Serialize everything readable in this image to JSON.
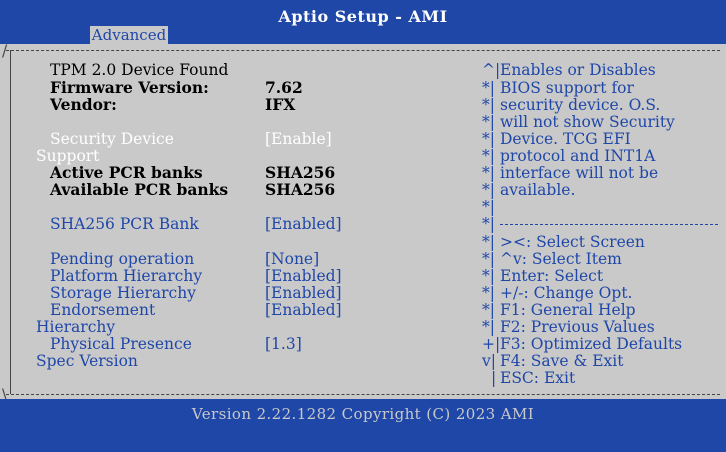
{
  "header": {
    "title": "Aptio Setup - AMI",
    "tab_label": "Advanced"
  },
  "left": {
    "tpm_found": "TPM 2.0 Device Found",
    "firmware_label": "Firmware Version:",
    "firmware_value": "7.62",
    "vendor_label": "Vendor:",
    "vendor_value": "IFX",
    "security_label": "Security Device",
    "security_value": "[Enable]",
    "security_support": "Support",
    "active_pcr_label": "Active PCR banks",
    "active_pcr_value": "SHA256",
    "available_pcr_label": "Available PCR banks",
    "available_pcr_value": "SHA256",
    "sha256_label": "SHA256 PCR Bank",
    "sha256_value": "[Enabled]",
    "pending_label": "Pending operation",
    "pending_value": "[None]",
    "platform_label": "Platform Hierarchy",
    "platform_value": "[Enabled]",
    "storage_label": "Storage Hierarchy",
    "storage_value": "[Enabled]",
    "endorsement_label": "Endorsement",
    "endorsement_value": "[Enabled]",
    "hierarchy_label": "Hierarchy",
    "physical_label": "Physical Presence",
    "physical_value": "[1.3]",
    "spec_label": "Spec Version"
  },
  "help": {
    "lines": [
      "Enables or Disables",
      "BIOS support for",
      "security device. O.S.",
      "will not show Security",
      "Device. TCG EFI",
      "protocol and INT1A",
      "interface will not be",
      "available."
    ],
    "keys": [
      "><: Select Screen",
      "^v: Select Item",
      "Enter: Select",
      "+/-: Change Opt.",
      "F1: General Help",
      "F2: Previous Values",
      "F3: Optimized Defaults",
      "F4: Save & Exit",
      "ESC: Exit"
    ],
    "markers": [
      "^",
      "*",
      "*",
      "*",
      "*",
      "*",
      "*",
      "*",
      "*",
      "*",
      "*",
      "*",
      "*",
      "*",
      "*",
      "*",
      "+",
      "v"
    ]
  },
  "footer": {
    "version": "Version 2.22.1282 Copyright (C) 2023 AMI"
  }
}
